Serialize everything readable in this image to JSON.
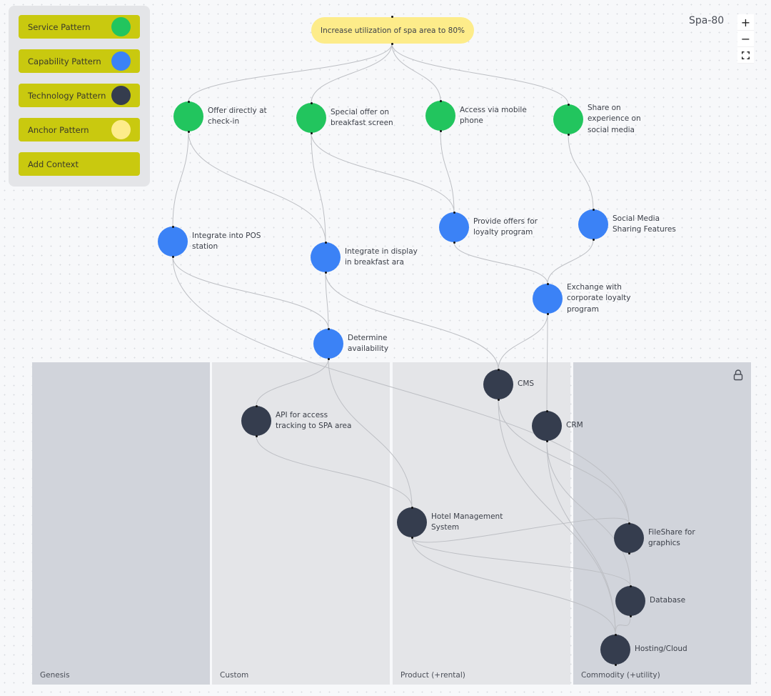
{
  "map_title": "Spa-80",
  "palette": {
    "items": [
      {
        "label": "Service Pattern",
        "color": "#22c55e"
      },
      {
        "label": "Capability Pattern",
        "color": "#3b82f6"
      },
      {
        "label": "Technology Pattern",
        "color": "#353d4e"
      },
      {
        "label": "Anchor Pattern",
        "color": "#fdec8a"
      },
      {
        "label": "Add Context"
      }
    ],
    "button_color": "#c9c90f"
  },
  "zoom_controls": {
    "zoom_in": "+",
    "zoom_out": "−",
    "fit": "⛶"
  },
  "lanes": [
    {
      "label": "Genesis"
    },
    {
      "label": "Custom"
    },
    {
      "label": "Product (+rental)"
    },
    {
      "label": "Commodity (+utility)",
      "locked": true
    }
  ],
  "anchor": {
    "label": "Increase utilization of spa area to 80%"
  },
  "nodes": {
    "offer_checkin": {
      "type": "service",
      "label": "Offer directly at\ncheck-in"
    },
    "special_offer": {
      "type": "service",
      "label": "Special offer on\nbreakfast screen"
    },
    "mobile_access": {
      "type": "service",
      "label": "Access via mobile\nphone"
    },
    "share_social": {
      "type": "service",
      "label": "Share on\nexperience on\nsocial media"
    },
    "pos": {
      "type": "capability",
      "label": "Integrate into POS\nstation"
    },
    "display": {
      "type": "capability",
      "label": "Integrate in display\nin breakfast ara"
    },
    "loyalty_offers": {
      "type": "capability",
      "label": "Provide offers for\nloyalty program"
    },
    "social_features": {
      "type": "capability",
      "label": "Social Media\nSharing Features"
    },
    "exchange": {
      "type": "capability",
      "label": "Exchange with\ncorporate loyalty\nprogram"
    },
    "determine": {
      "type": "capability",
      "label": "Determine\navailability"
    },
    "api": {
      "type": "technology",
      "label": "API for access\ntracking to SPA area"
    },
    "cms": {
      "type": "technology",
      "label": "CMS"
    },
    "crm": {
      "type": "technology",
      "label": "CRM"
    },
    "hms": {
      "type": "technology",
      "label": "Hotel Management\nSystem"
    },
    "fileshare": {
      "type": "technology",
      "label": "FileShare for\ngraphics"
    },
    "database": {
      "type": "technology",
      "label": "Database"
    },
    "hosting": {
      "type": "technology",
      "label": "Hosting/Cloud"
    }
  },
  "edges": [
    [
      "anchor",
      "offer_checkin"
    ],
    [
      "anchor",
      "special_offer"
    ],
    [
      "anchor",
      "mobile_access"
    ],
    [
      "anchor",
      "share_social"
    ],
    [
      "offer_checkin",
      "pos"
    ],
    [
      "offer_checkin",
      "display"
    ],
    [
      "special_offer",
      "display"
    ],
    [
      "special_offer",
      "loyalty_offers"
    ],
    [
      "mobile_access",
      "loyalty_offers"
    ],
    [
      "share_social",
      "social_features"
    ],
    [
      "pos",
      "determine"
    ],
    [
      "pos",
      "fileshare"
    ],
    [
      "display",
      "determine"
    ],
    [
      "display",
      "cms"
    ],
    [
      "loyalty_offers",
      "exchange"
    ],
    [
      "social_features",
      "exchange"
    ],
    [
      "exchange",
      "cms"
    ],
    [
      "exchange",
      "crm"
    ],
    [
      "determine",
      "api"
    ],
    [
      "determine",
      "hms"
    ],
    [
      "api",
      "hms"
    ],
    [
      "cms",
      "fileshare"
    ],
    [
      "cms",
      "hosting"
    ],
    [
      "crm",
      "database"
    ],
    [
      "crm",
      "hosting"
    ],
    [
      "hms",
      "fileshare"
    ],
    [
      "hms",
      "database"
    ],
    [
      "hms",
      "hosting"
    ],
    [
      "database",
      "hosting"
    ]
  ]
}
